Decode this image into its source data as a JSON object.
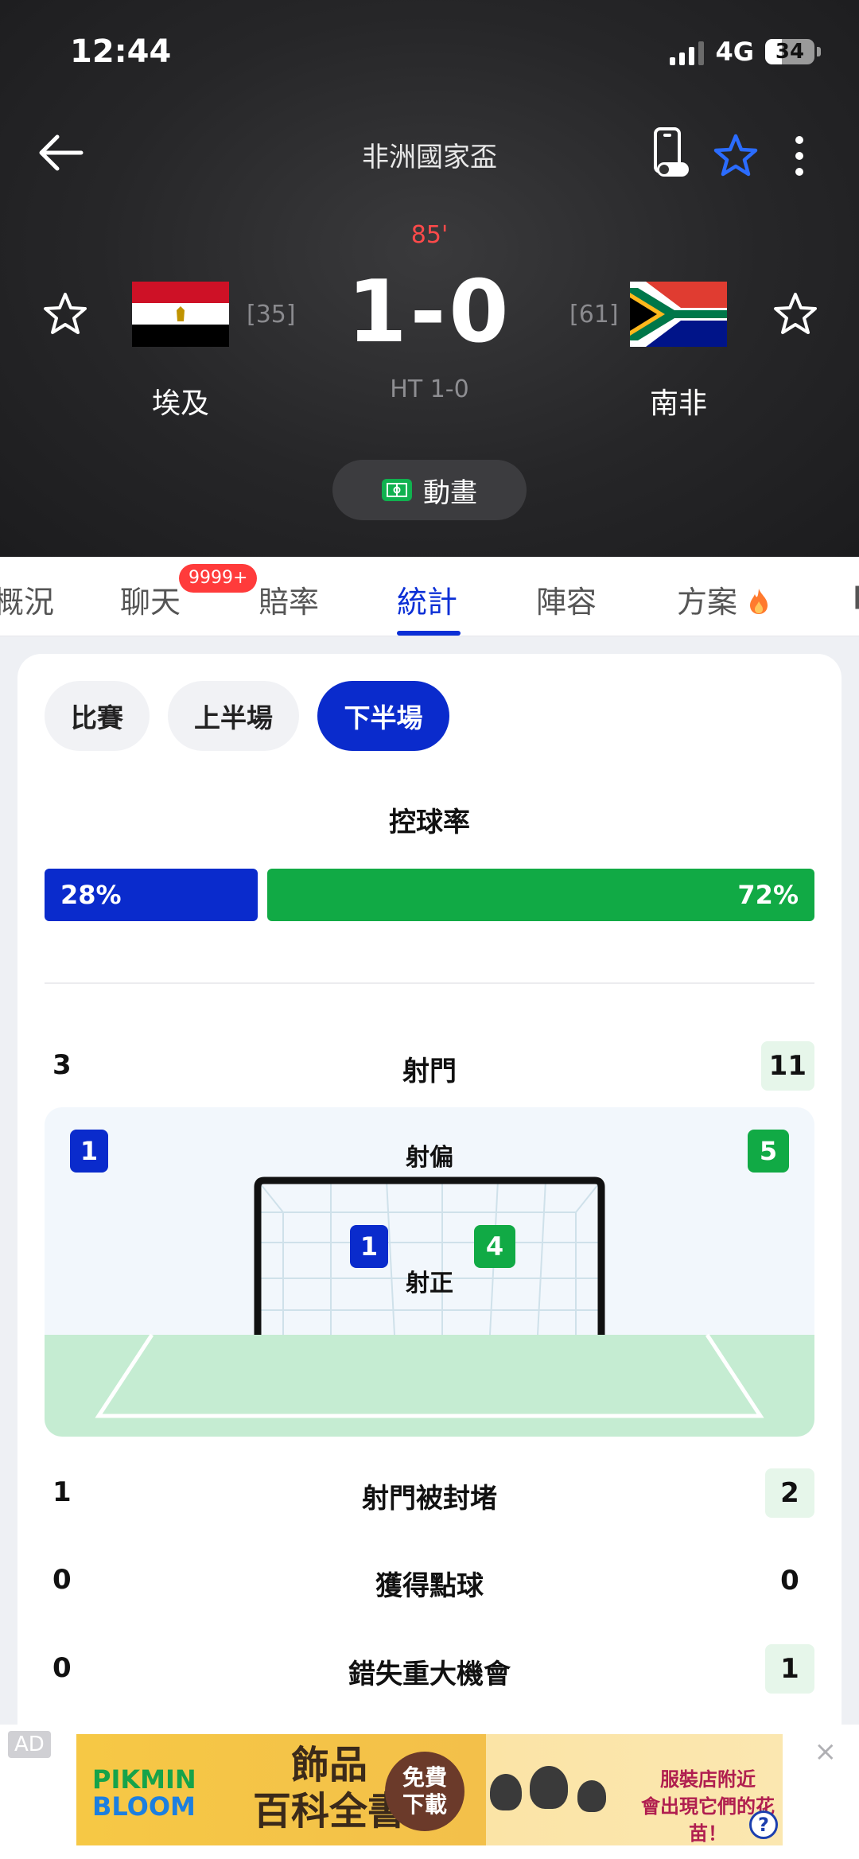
{
  "status_bar": {
    "time": "12:44",
    "network": "4G",
    "battery": "34"
  },
  "header": {
    "competition": "非洲國家盃",
    "minute": "85'",
    "score": "1-0",
    "halftime": "HT 1-0",
    "home": {
      "name": "埃及",
      "rank": "[35]"
    },
    "away": {
      "name": "南非",
      "rank": "[61]"
    },
    "animation_label": "動畫"
  },
  "tabs": {
    "items": [
      "概況",
      "聊天",
      "賠率",
      "統計",
      "陣容",
      "方案"
    ],
    "active": "統計",
    "chat_badge": "9999+"
  },
  "period_filter": {
    "items": [
      "比賽",
      "上半場",
      "下半場"
    ],
    "active": "下半場"
  },
  "possession": {
    "title": "控球率",
    "home": "28%",
    "away": "72%",
    "home_value": 28,
    "away_value": 72
  },
  "stats": {
    "shots": {
      "label": "射門",
      "home": "3",
      "away": "11"
    },
    "off_target": {
      "label": "射偏",
      "home": "1",
      "away": "5"
    },
    "on_target": {
      "label": "射正",
      "home": "1",
      "away": "4"
    },
    "blocked": {
      "label": "射門被封堵",
      "home": "1",
      "away": "2"
    },
    "penalties": {
      "label": "獲得點球",
      "home": "0",
      "away": "0"
    },
    "big_chances_missed": {
      "label": "錯失重大機會",
      "home": "0",
      "away": "1"
    }
  },
  "ad": {
    "tag": "AD",
    "close": "×",
    "brand_line1": "PIKMIN",
    "brand_line2": "BLOOM",
    "headline_line1": "飾品",
    "headline_line2": "百科全書",
    "cta_line1": "免費",
    "cta_line2": "下載",
    "side_line1": "服裝店附近",
    "side_line2": "會出現它們的花苗！",
    "help": "?"
  },
  "colors": {
    "home_blue": "#0a2bcc",
    "away_green": "#11aa45",
    "accent_red": "#ff3b3b",
    "tab_active": "#0b2fd6"
  }
}
